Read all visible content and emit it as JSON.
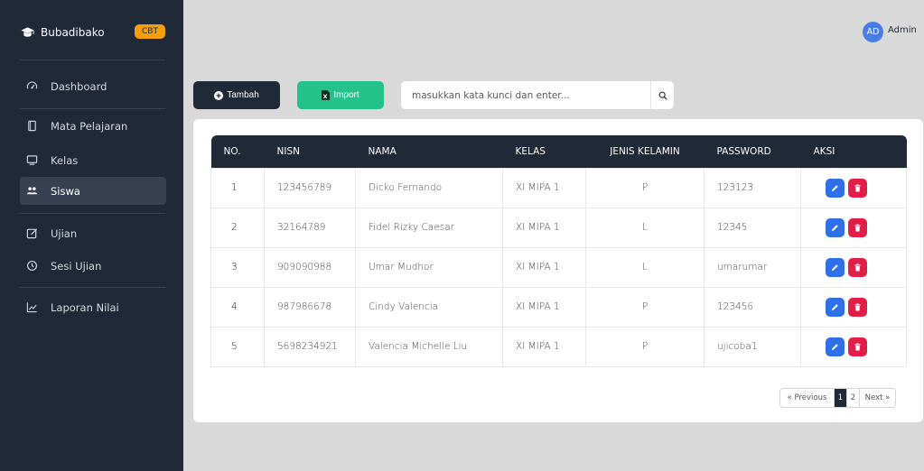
{
  "sidebar": {
    "brand": "Bubadibako",
    "badge": "CBT",
    "items": [
      {
        "label": "Dashboard",
        "icon": "dashboard-icon",
        "active": false
      },
      {
        "label": "Mata Pelajaran",
        "icon": "book-icon",
        "active": false
      },
      {
        "label": "Kelas",
        "icon": "classroom-icon",
        "active": false
      },
      {
        "label": "Siswa",
        "icon": "users-icon",
        "active": true
      },
      {
        "label": "Ujian",
        "icon": "edit-icon",
        "active": false
      },
      {
        "label": "Sesi Ujian",
        "icon": "clock-icon",
        "active": false
      },
      {
        "label": "Laporan Nilai",
        "icon": "chart-line-icon",
        "active": false
      }
    ]
  },
  "topbar": {
    "avatar_initials": "AD",
    "user_name": "Admin"
  },
  "toolbar": {
    "add_label": "Tambah",
    "import_label": "Import",
    "search_placeholder": "masukkan kata kunci dan enter..."
  },
  "table": {
    "headers": [
      "NO.",
      "NISN",
      "NAMA",
      "KELAS",
      "JENIS KELAMIN",
      "PASSWORD",
      "AKSI"
    ],
    "rows": [
      {
        "no": "1",
        "nisn": "123456789",
        "nama": "Dicko Fernando",
        "kelas": "XI MIPA 1",
        "jk": "P",
        "password": "123123"
      },
      {
        "no": "2",
        "nisn": "32164789",
        "nama": "Fidel Rizky Caesar",
        "kelas": "XI MIPA 1",
        "jk": "L",
        "password": "12345"
      },
      {
        "no": "3",
        "nisn": "909090988",
        "nama": "Umar Mudhor",
        "kelas": "XI MIPA 1",
        "jk": "L",
        "password": "umarumar"
      },
      {
        "no": "4",
        "nisn": "987986678",
        "nama": "Cindy Valencia",
        "kelas": "XI MIPA 1",
        "jk": "P",
        "password": "123456"
      },
      {
        "no": "5",
        "nisn": "5698234921",
        "nama": "Valencia Michelle Liu",
        "kelas": "XI MIPA 1",
        "jk": "P",
        "password": "ujicoba1"
      }
    ]
  },
  "pagination": {
    "prev": "« Previous",
    "pages": [
      "1",
      "2"
    ],
    "current": "1",
    "next": "Next »"
  },
  "colors": {
    "sidebar_bg": "#1f2937",
    "accent_green": "#22c28a",
    "edit_blue": "#2f6fe8",
    "delete_red": "#e11d48",
    "badge_orange": "#f59e0b"
  }
}
